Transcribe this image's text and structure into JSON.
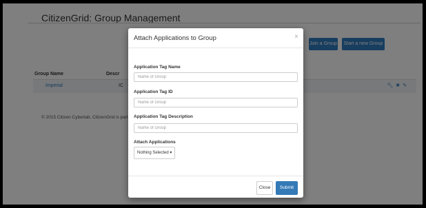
{
  "app": {
    "title": "CitizenGrid: Group Management"
  },
  "actions": {
    "join_label": "Join a Group",
    "start_label": "Start a new Group"
  },
  "table": {
    "headers": [
      "Group Name",
      "Descr"
    ],
    "rows": [
      {
        "name": "Imperial",
        "description": "IC"
      }
    ],
    "row_icons": [
      "wrench-icon",
      "trash-icon",
      "link-icon"
    ]
  },
  "footer": {
    "text": "© 2015 Citizen Cyberlab. CitizenGrid is part o"
  },
  "modal": {
    "title": "Attach Applications to Group",
    "close_symbol": "×",
    "fields": [
      {
        "label": "Application Tag Name",
        "placeholder": "Name of Group"
      },
      {
        "label": "Application Tag ID",
        "placeholder": "Name of Group"
      },
      {
        "label": "Application Tag Description",
        "placeholder": "Name of Group"
      }
    ],
    "attach_label": "Attach Applications",
    "dropdown_value": "Nothing Selected ▾",
    "close_label": "Close",
    "submit_label": "Submit"
  },
  "colors": {
    "primary": "#337ab7",
    "overlay": "rgba(0,0,0,0.5)"
  }
}
